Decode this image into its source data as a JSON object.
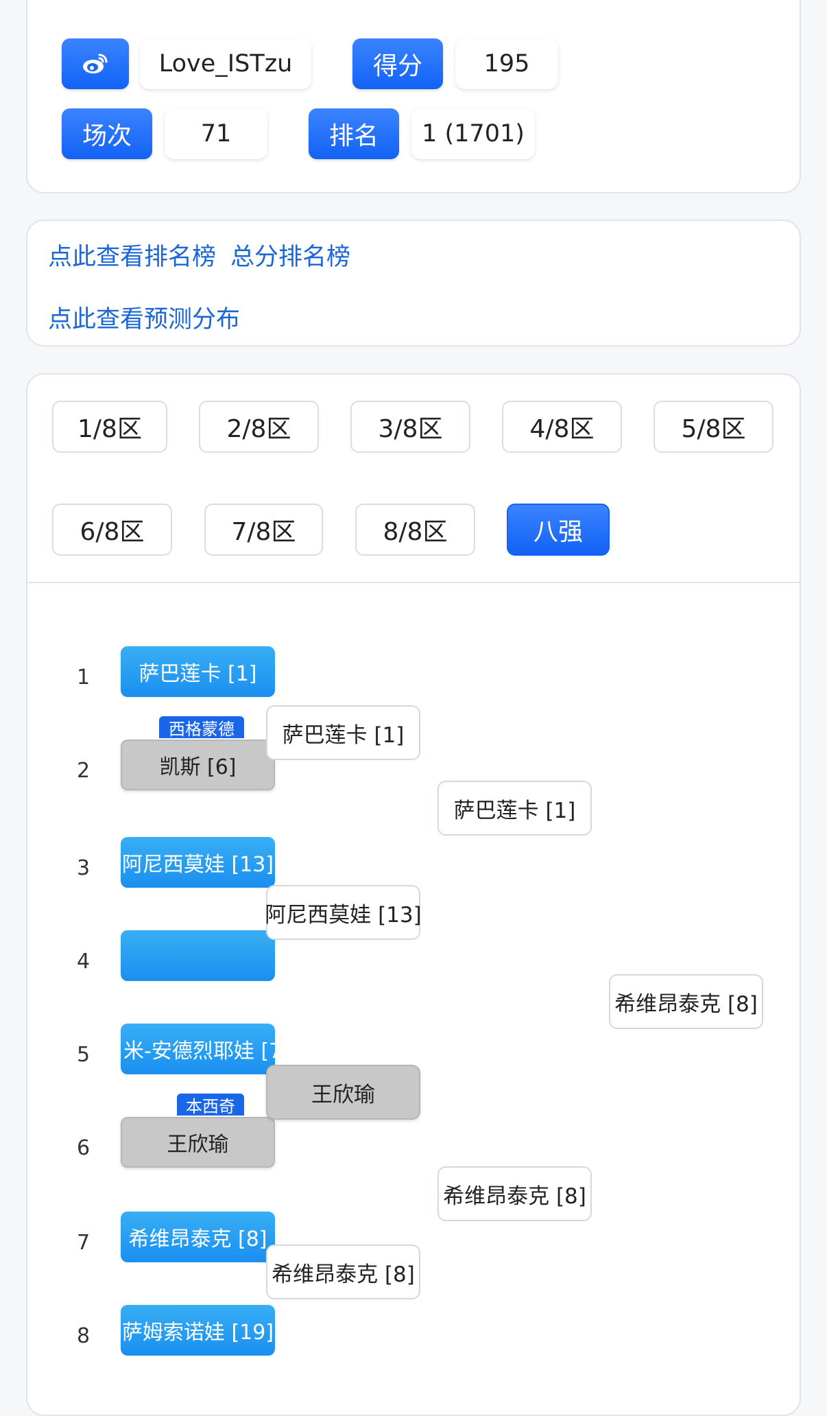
{
  "profile": {
    "weibo_icon": "weibo-icon",
    "username": "Love_ISTzu",
    "score_label": "得分",
    "score_value": "195",
    "matches_label": "场次",
    "matches_value": "71",
    "rank_label": "排名",
    "rank_value": "1 (1701)"
  },
  "links": {
    "ranking": "点此查看排名榜",
    "total_ranking": "总分排名榜",
    "prediction": "点此查看预测分布"
  },
  "zones": [
    "1/8区",
    "2/8区",
    "3/8区",
    "4/8区",
    "5/8区",
    "6/8区",
    "7/8区",
    "8/8区",
    "八强"
  ],
  "active_zone": "八强",
  "bracket": {
    "round1": [
      {
        "seed": "1",
        "player": "萨巴莲卡 [1]",
        "status": "pick"
      },
      {
        "seed": "2",
        "player": "凯斯 [6]",
        "status": "lost",
        "note": "西格蒙德"
      },
      {
        "seed": "3",
        "player": "阿尼西莫娃 [13]",
        "status": "pick"
      },
      {
        "seed": "4",
        "player": "",
        "status": "pick"
      },
      {
        "seed": "5",
        "player": "米-安德烈耶娃 [7",
        "status": "pick"
      },
      {
        "seed": "6",
        "player": "王欣瑜",
        "status": "lost",
        "note": "本西奇"
      },
      {
        "seed": "7",
        "player": "希维昂泰克 [8]",
        "status": "pick"
      },
      {
        "seed": "8",
        "player": "萨姆索诺娃 [19]",
        "status": "pick"
      }
    ],
    "round2": [
      "萨巴莲卡 [1]",
      "阿尼西莫娃 [13]",
      "王欣瑜",
      "希维昂泰克 [8]"
    ],
    "round3": [
      "萨巴莲卡 [1]",
      "希维昂泰克 [8]"
    ],
    "final": "希维昂泰克 [8]"
  }
}
